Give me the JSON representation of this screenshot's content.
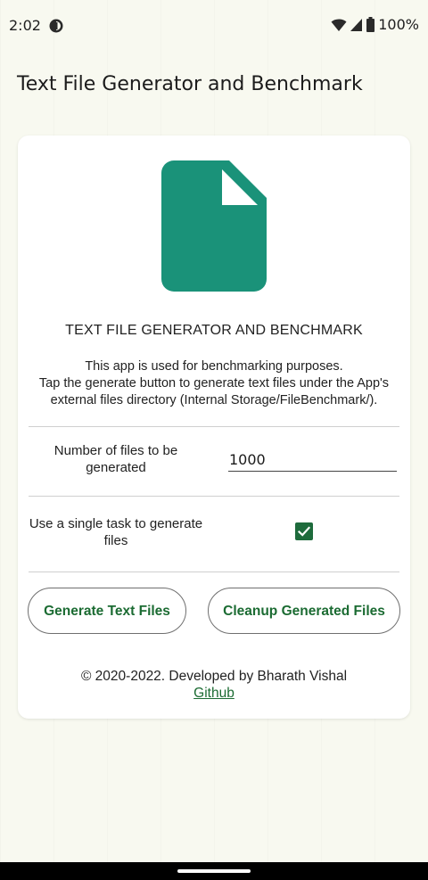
{
  "status_bar": {
    "time": "2:02",
    "battery": "100%",
    "icons": [
      "app-notification-icon",
      "wifi-icon",
      "signal-icon",
      "battery-icon"
    ]
  },
  "app_bar": {
    "title": "Text File Generator and Benchmark"
  },
  "card": {
    "icon": "file-icon",
    "heading": "TEXT FILE GENERATOR AND BENCHMARK",
    "description": [
      "This app is used for benchmarking purposes.",
      "Tap the generate button to generate text files under the App's",
      "external files directory (Internal Storage/FileBenchmark/)."
    ],
    "files_count": {
      "label": "Number of files to be generated",
      "value": "1000"
    },
    "single_task": {
      "label": "Use a single task to generate files",
      "checked": true
    },
    "buttons": {
      "generate": "Generate Text Files",
      "cleanup": "Cleanup Generated Files"
    },
    "footer": {
      "copyright": "© 2020-2022. Developed by Bharath Vishal",
      "link": "Github"
    }
  },
  "colors": {
    "accent": "#1b6b32",
    "icon": "#1a9279",
    "background": "#f8f9f0"
  }
}
